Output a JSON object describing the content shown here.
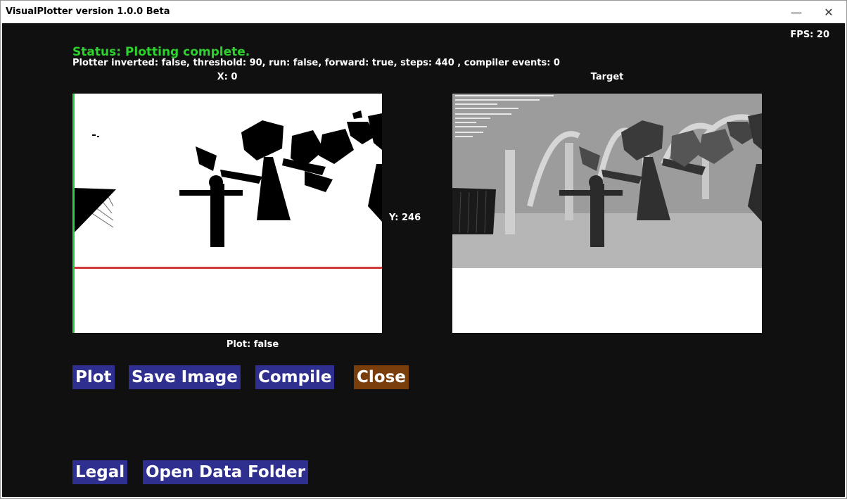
{
  "window": {
    "title": "VisualPlotter version 1.0.0 Beta",
    "minimize_glyph": "—",
    "close_glyph": "✕"
  },
  "fps": "FPS: 20",
  "status": "Status: Plotting complete.",
  "info": "Plotter inverted: false, threshold: 90, run: false, forward: true, steps: 440 , compiler events: 0",
  "x_label": "X: 0",
  "target_label": "Target",
  "y_label": "Y: 246",
  "plot_label": "Plot: false",
  "buttons": {
    "plot": "Plot",
    "save_image": "Save Image",
    "compile": "Compile",
    "close": "Close",
    "legal": "Legal",
    "open_data_folder": "Open Data Folder"
  },
  "colors": {
    "status_green": "#2ed12e",
    "button_blue": "#2f2f8f",
    "button_close": "#7a3e0c",
    "scan_red": "#d23a3a",
    "scan_green": "#2ecc40",
    "background": "#101010"
  }
}
